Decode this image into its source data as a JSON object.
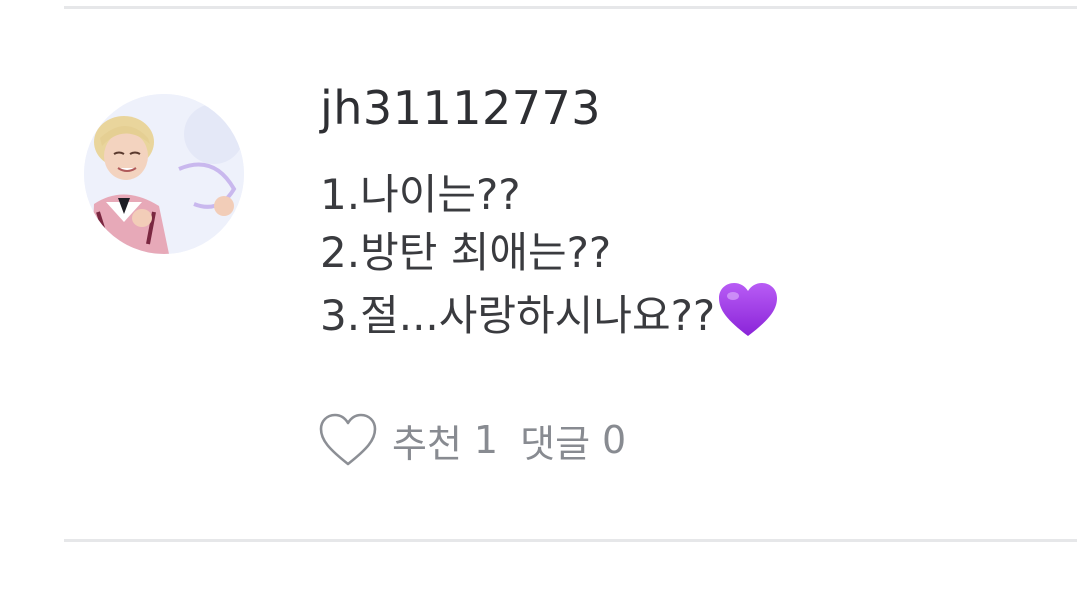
{
  "comment": {
    "username": "jh31112773",
    "lines": [
      "1.나이는??",
      "2.방탄 최애는??",
      "3.절...사랑하시나요??"
    ],
    "trailing_emoji": "purple-heart-emoji"
  },
  "actions": {
    "like_label": "추천",
    "like_count": "1",
    "comment_label": "댓글",
    "comment_count": "0"
  },
  "colors": {
    "username": "#2e2f33",
    "text": "#3a3b3f",
    "meta": "#888b91",
    "heart_emoji": "#a33df0",
    "divider": "#e6e7e9"
  }
}
